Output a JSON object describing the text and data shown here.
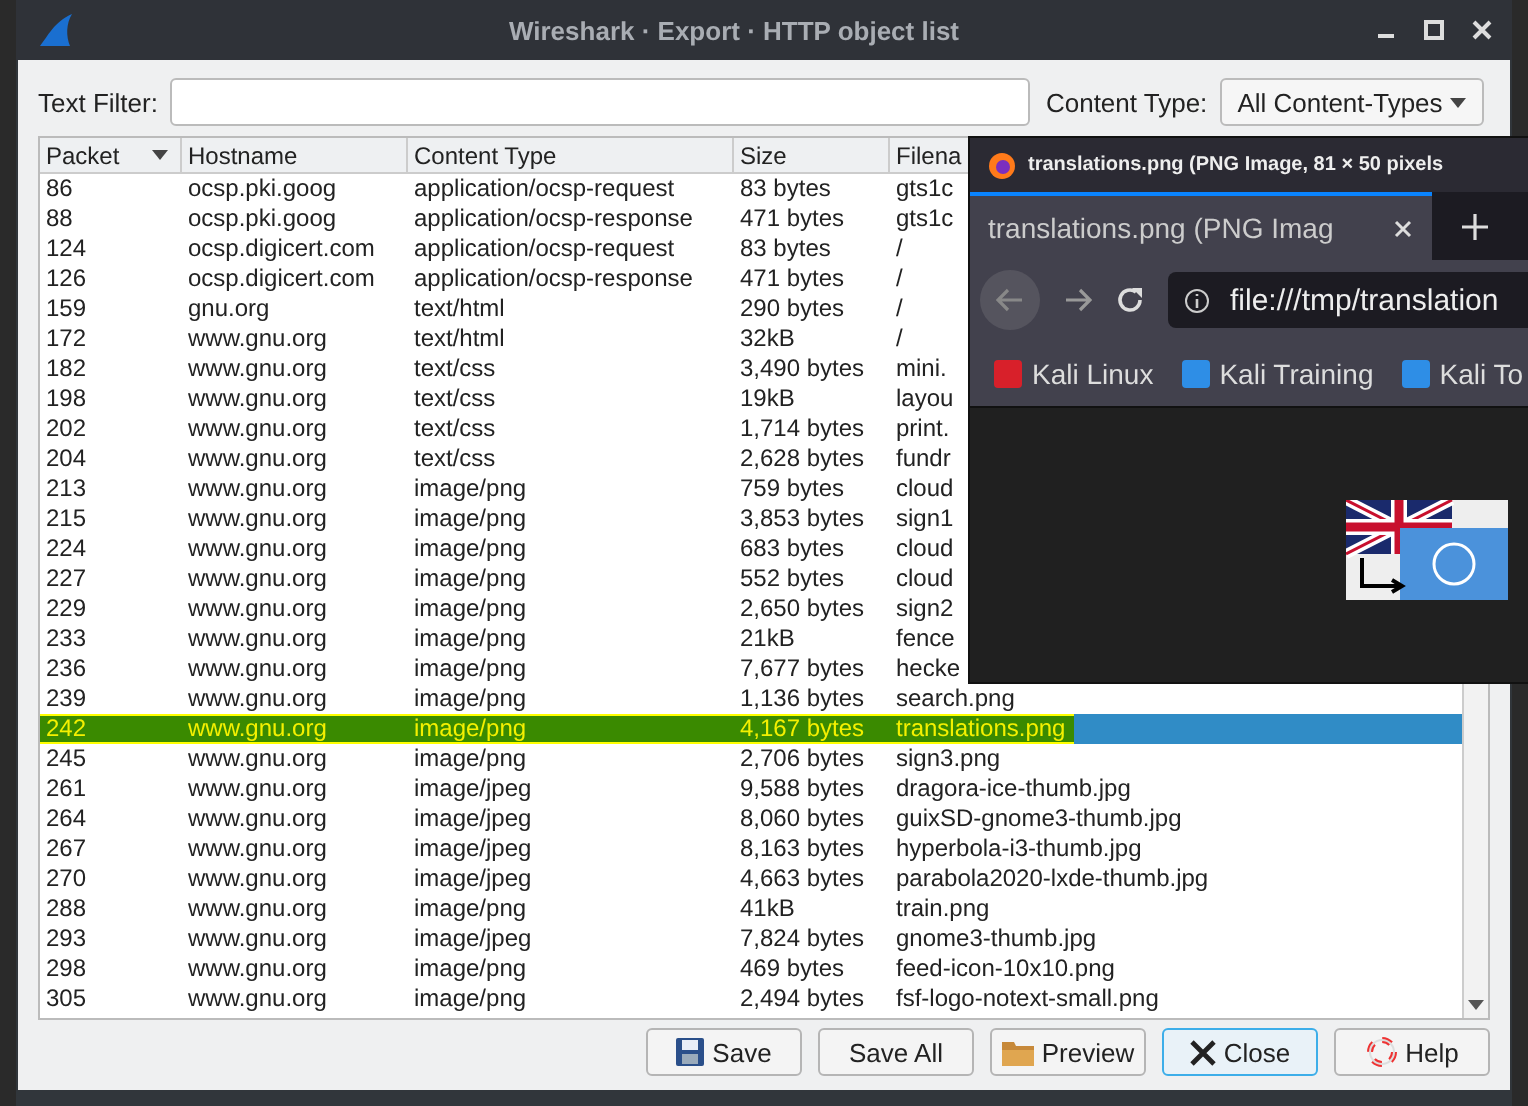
{
  "window": {
    "title": "Wireshark · Export · HTTP object list"
  },
  "text_filter": {
    "label": "Text Filter:"
  },
  "content_type": {
    "label": "Content Type:",
    "value": "All Content-Types"
  },
  "table": {
    "columns": [
      "Packet",
      "Hostname",
      "Content Type",
      "Size",
      "Filena"
    ],
    "rows": [
      {
        "packet": "86",
        "hostname": "ocsp.pki.goog",
        "content_type": "application/ocsp-request",
        "size": "83 bytes",
        "filename": "gts1c",
        "selected": false
      },
      {
        "packet": "88",
        "hostname": "ocsp.pki.goog",
        "content_type": "application/ocsp-response",
        "size": "471 bytes",
        "filename": "gts1c",
        "selected": false
      },
      {
        "packet": "124",
        "hostname": "ocsp.digicert.com",
        "content_type": "application/ocsp-request",
        "size": "83 bytes",
        "filename": "/",
        "selected": false
      },
      {
        "packet": "126",
        "hostname": "ocsp.digicert.com",
        "content_type": "application/ocsp-response",
        "size": "471 bytes",
        "filename": "/",
        "selected": false
      },
      {
        "packet": "159",
        "hostname": "gnu.org",
        "content_type": "text/html",
        "size": "290 bytes",
        "filename": "/",
        "selected": false
      },
      {
        "packet": "172",
        "hostname": "www.gnu.org",
        "content_type": "text/html",
        "size": "32kB",
        "filename": "/",
        "selected": false
      },
      {
        "packet": "182",
        "hostname": "www.gnu.org",
        "content_type": "text/css",
        "size": "3,490 bytes",
        "filename": "mini.",
        "selected": false
      },
      {
        "packet": "198",
        "hostname": "www.gnu.org",
        "content_type": "text/css",
        "size": "19kB",
        "filename": "layou",
        "selected": false
      },
      {
        "packet": "202",
        "hostname": "www.gnu.org",
        "content_type": "text/css",
        "size": "1,714 bytes",
        "filename": "print.",
        "selected": false
      },
      {
        "packet": "204",
        "hostname": "www.gnu.org",
        "content_type": "text/css",
        "size": "2,628 bytes",
        "filename": "fundr",
        "selected": false
      },
      {
        "packet": "213",
        "hostname": "www.gnu.org",
        "content_type": "image/png",
        "size": "759 bytes",
        "filename": "cloud",
        "selected": false
      },
      {
        "packet": "215",
        "hostname": "www.gnu.org",
        "content_type": "image/png",
        "size": "3,853 bytes",
        "filename": "sign1",
        "selected": false
      },
      {
        "packet": "224",
        "hostname": "www.gnu.org",
        "content_type": "image/png",
        "size": "683 bytes",
        "filename": "cloud",
        "selected": false
      },
      {
        "packet": "227",
        "hostname": "www.gnu.org",
        "content_type": "image/png",
        "size": "552 bytes",
        "filename": "cloud",
        "selected": false
      },
      {
        "packet": "229",
        "hostname": "www.gnu.org",
        "content_type": "image/png",
        "size": "2,650 bytes",
        "filename": "sign2",
        "selected": false
      },
      {
        "packet": "233",
        "hostname": "www.gnu.org",
        "content_type": "image/png",
        "size": "21kB",
        "filename": "fence",
        "selected": false
      },
      {
        "packet": "236",
        "hostname": "www.gnu.org",
        "content_type": "image/png",
        "size": "7,677 bytes",
        "filename": "hecke",
        "selected": false
      },
      {
        "packet": "239",
        "hostname": "www.gnu.org",
        "content_type": "image/png",
        "size": "1,136 bytes",
        "filename": "search.png",
        "selected": false
      },
      {
        "packet": "242",
        "hostname": "www.gnu.org",
        "content_type": "image/png",
        "size": "4,167 bytes",
        "filename": "translations.png",
        "selected": true
      },
      {
        "packet": "245",
        "hostname": "www.gnu.org",
        "content_type": "image/png",
        "size": "2,706 bytes",
        "filename": "sign3.png",
        "selected": false
      },
      {
        "packet": "261",
        "hostname": "www.gnu.org",
        "content_type": "image/jpeg",
        "size": "9,588 bytes",
        "filename": "dragora-ice-thumb.jpg",
        "selected": false
      },
      {
        "packet": "264",
        "hostname": "www.gnu.org",
        "content_type": "image/jpeg",
        "size": "8,060 bytes",
        "filename": "guixSD-gnome3-thumb.jpg",
        "selected": false
      },
      {
        "packet": "267",
        "hostname": "www.gnu.org",
        "content_type": "image/jpeg",
        "size": "8,163 bytes",
        "filename": "hyperbola-i3-thumb.jpg",
        "selected": false
      },
      {
        "packet": "270",
        "hostname": "www.gnu.org",
        "content_type": "image/jpeg",
        "size": "4,663 bytes",
        "filename": "parabola2020-lxde-thumb.jpg",
        "selected": false
      },
      {
        "packet": "288",
        "hostname": "www.gnu.org",
        "content_type": "image/png",
        "size": "41kB",
        "filename": "train.png",
        "selected": false
      },
      {
        "packet": "293",
        "hostname": "www.gnu.org",
        "content_type": "image/jpeg",
        "size": "7,824 bytes",
        "filename": "gnome3-thumb.jpg",
        "selected": false
      },
      {
        "packet": "298",
        "hostname": "www.gnu.org",
        "content_type": "image/png",
        "size": "469 bytes",
        "filename": "feed-icon-10x10.png",
        "selected": false
      },
      {
        "packet": "305",
        "hostname": "www.gnu.org",
        "content_type": "image/png",
        "size": "2,494 bytes",
        "filename": "fsf-logo-notext-small.png",
        "selected": false
      }
    ]
  },
  "buttons": [
    {
      "label": "Save",
      "kind": "save",
      "focused": false
    },
    {
      "label": "Save All",
      "kind": "plain",
      "focused": false
    },
    {
      "label": "Preview",
      "kind": "preview",
      "focused": false
    },
    {
      "label": "Close",
      "kind": "close",
      "focused": true
    },
    {
      "label": "Help",
      "kind": "help",
      "focused": false
    }
  ],
  "browser_window": {
    "title": "translations.png (PNG Image, 81 × 50 pixels",
    "tab": {
      "label": "translations.png (PNG Imag",
      "selected": true
    },
    "url": "file:///tmp/translation",
    "bookmarks": [
      {
        "label": "Kali Linux",
        "color": "#d8202a"
      },
      {
        "label": "Kali Training",
        "color": "#2e8ee6"
      },
      {
        "label": "Kali To",
        "color": "#2e8ee6"
      }
    ]
  }
}
